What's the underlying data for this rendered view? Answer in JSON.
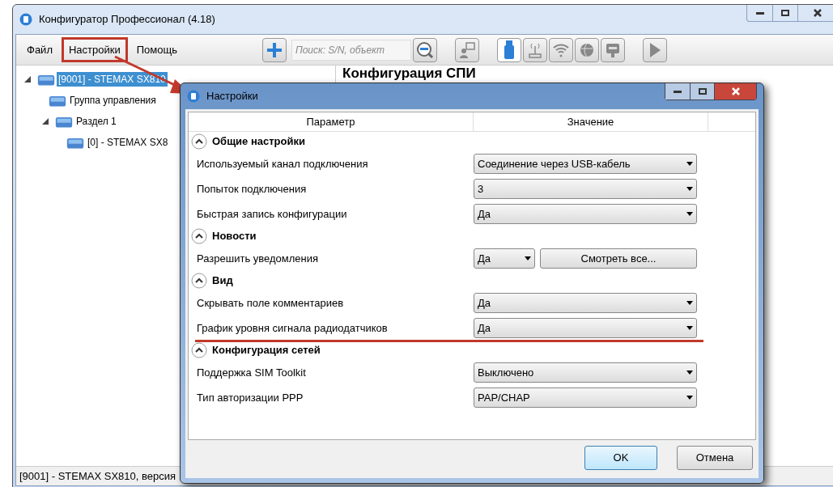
{
  "window": {
    "title": "Конфигуратор Профессионал (4.18)"
  },
  "menu": [
    {
      "label": "Файл",
      "highlighted": false
    },
    {
      "label": "Настройки",
      "highlighted": true
    },
    {
      "label": "Помощь",
      "highlighted": false
    }
  ],
  "search": {
    "placeholder": "Поиск: S/N, объект"
  },
  "tree": [
    {
      "label": "[9001] - STEMAX SX810",
      "selected": true,
      "expanded": true,
      "children": [
        {
          "label": "Группа управления",
          "selected": false
        },
        {
          "label": "Раздел 1",
          "selected": false,
          "expanded": true,
          "children": [
            {
              "label": "[0] - STEMAX SX8",
              "selected": false
            }
          ]
        }
      ]
    }
  ],
  "content": {
    "title": "Конфигурация СПИ"
  },
  "status_bar": "[9001] - STEMAX SX810, версия",
  "dialog": {
    "title": "Настройки",
    "columns": [
      "Параметр",
      "Значение"
    ],
    "sections": [
      {
        "title": "Общие настройки",
        "expanded": true,
        "rows": [
          {
            "label": "Используемый канал подключения",
            "value": "Соединение через USB-кабель",
            "underlined": false
          },
          {
            "label": "Попыток подключения",
            "value": "3",
            "underlined": false
          },
          {
            "label": "Быстрая запись конфигурации",
            "value": "Да",
            "underlined": false
          }
        ]
      },
      {
        "title": "Новости",
        "expanded": true,
        "rows": [
          {
            "label": "Разрешить уведомления",
            "value": "Да",
            "button": "Смотреть все...",
            "underlined": false
          }
        ]
      },
      {
        "title": "Вид",
        "expanded": true,
        "rows": [
          {
            "label": "Скрывать поле комментариев",
            "value": "Да",
            "underlined": false
          },
          {
            "label": "График уровня сигнала радиодатчиков",
            "value": "Да",
            "underlined": true
          }
        ]
      },
      {
        "title": "Конфигурация сетей",
        "expanded": true,
        "rows": [
          {
            "label": "Поддержка SIM Toolkit",
            "value": "Выключено",
            "underlined": false
          },
          {
            "label": "Тип авторизации PPP",
            "value": "PAP/CHAP",
            "underlined": false
          }
        ]
      }
    ],
    "buttons": [
      {
        "label": "OK",
        "default": true
      },
      {
        "label": "Отмена",
        "default": false
      }
    ]
  }
}
